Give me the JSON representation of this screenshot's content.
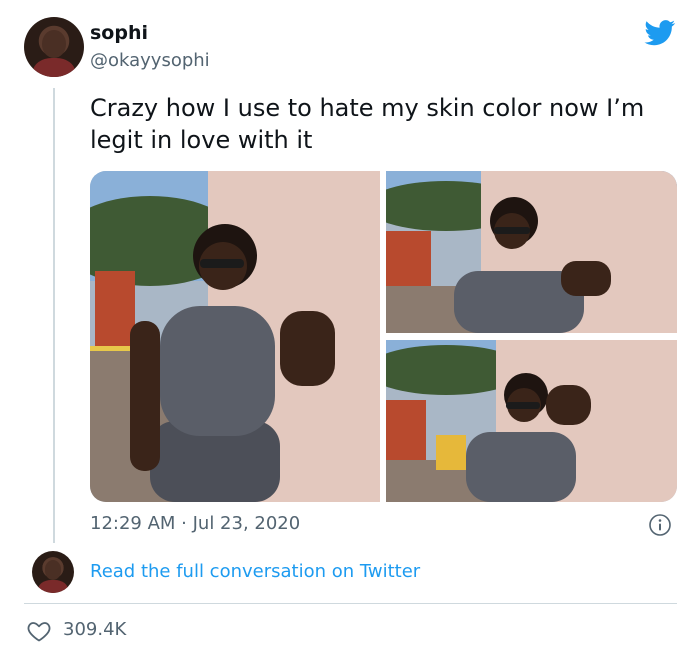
{
  "tweet": {
    "author_name": "sophi",
    "author_handle": "@okayysophi",
    "text": "Crazy how I use to hate my skin color now I’m legit in love with it",
    "timestamp": "12:29 AM · Jul 23, 2020",
    "read_link": "Read the full conversation on Twitter",
    "like_count": "309.4K"
  },
  "icons": {
    "logo": "twitter-bird-icon",
    "info": "info-icon",
    "like": "heart-icon"
  },
  "colors": {
    "brand": "#1d9bf0",
    "text": "#0f1419",
    "secondary": "#536471",
    "divider": "#cfd9de"
  }
}
